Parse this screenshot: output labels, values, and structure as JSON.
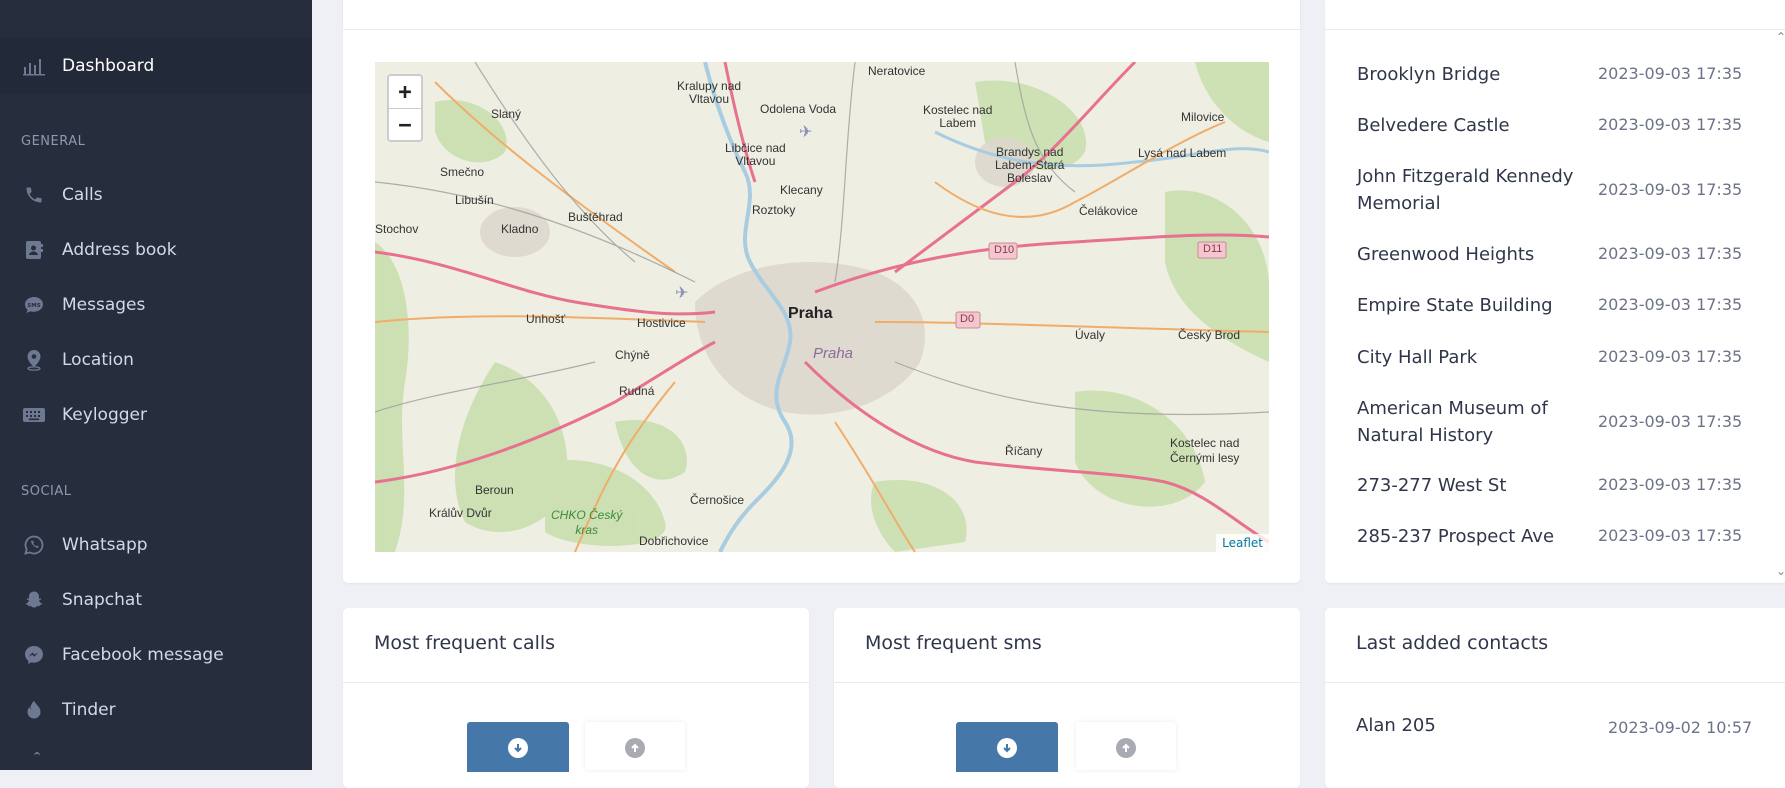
{
  "sidebar": {
    "dashboard": "Dashboard",
    "section_general": "GENERAL",
    "section_social": "SOCIAL",
    "general_items": [
      {
        "label": "Calls",
        "icon": "phone-icon"
      },
      {
        "label": "Address book",
        "icon": "contact-book-icon"
      },
      {
        "label": "Messages",
        "icon": "sms-icon"
      },
      {
        "label": "Location",
        "icon": "location-pin-icon"
      },
      {
        "label": "Keylogger",
        "icon": "keyboard-icon"
      }
    ],
    "social_items": [
      {
        "label": "Whatsapp",
        "icon": "whatsapp-icon"
      },
      {
        "label": "Snapchat",
        "icon": "snapchat-icon"
      },
      {
        "label": "Facebook message",
        "icon": "messenger-icon"
      },
      {
        "label": "Tinder",
        "icon": "tinder-flame-icon"
      }
    ]
  },
  "map": {
    "zoom_in": "+",
    "zoom_out": "−",
    "attribution": "Leaflet",
    "labels": {
      "kralupy": "Kralupy nad\nVltavou",
      "neratovice": "Neratovice",
      "odolena": "Odolena Voda",
      "kostelec_labem": "Kostelec nad\nLabem",
      "milovice": "Milovice",
      "slany": "Slaný",
      "libcice": "Libčice nad\nVltavou",
      "brandys": "Brandys nad\nLabem-Stará\nBoleslav",
      "lysa": "Lysá nad Labem",
      "smecno": "Smečno",
      "klecany": "Klecany",
      "libusin": "Libušín",
      "bustehrad": "Buštěhrad",
      "roztoky": "Roztoky",
      "celakovice": "Čelákovice",
      "stochov": "Stochov",
      "kladno": "Kladno",
      "d10": "D10",
      "d11": "D11",
      "unhost": "Unhošť",
      "hostivice": "Hostivice",
      "praha_city": "Praha",
      "d0": "D0",
      "uvaly": "Úvaly",
      "cesky_brod": "Český Brod",
      "chyne": "Chýně",
      "praha_region": "Praha",
      "rudna": "Rudná",
      "ricany": "Říčany",
      "kostelec_lesy": "Kostelec nad\nČernými lesy",
      "beroun": "Beroun",
      "cernosice": "Černošice",
      "kraluv_dvur": "Králův Dvůr",
      "chko": "CHKO Český\nkras",
      "dobrichovice": "Dobřichovice"
    }
  },
  "locations": [
    {
      "name": "Brooklyn Bridge",
      "time": "2023-09-03 17:35"
    },
    {
      "name": "Belvedere Castle",
      "time": "2023-09-03 17:35"
    },
    {
      "name": "John Fitzgerald Kennedy Memorial",
      "time": "2023-09-03 17:35"
    },
    {
      "name": "Greenwood Heights",
      "time": "2023-09-03 17:35"
    },
    {
      "name": "Empire State Building",
      "time": "2023-09-03 17:35"
    },
    {
      "name": "City Hall Park",
      "time": "2023-09-03 17:35"
    },
    {
      "name": "American Museum of Natural History",
      "time": "2023-09-03 17:35"
    },
    {
      "name": "273-277 West St",
      "time": "2023-09-03 17:35"
    },
    {
      "name": "285-237 Prospect Ave",
      "time": "2023-09-03 17:35"
    }
  ],
  "cards": {
    "calls_title": "Most frequent calls",
    "sms_title": "Most frequent sms",
    "contacts_title": "Last added contacts"
  },
  "contacts": [
    {
      "name": "Alan 205",
      "time": "2023-09-02 10:57"
    }
  ],
  "colors": {
    "sidebar_bg": "#262d3d",
    "accent_button": "#4577a8",
    "page_bg": "#eef0f6"
  }
}
